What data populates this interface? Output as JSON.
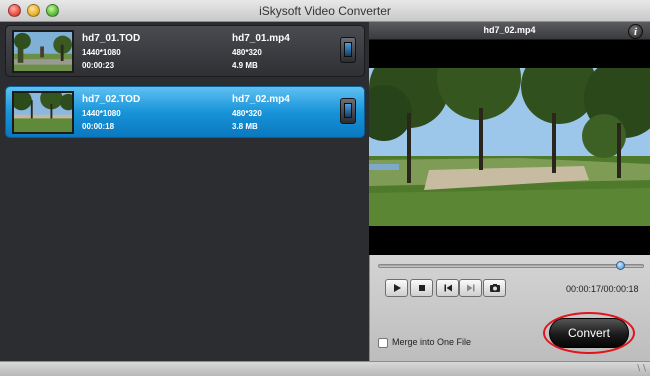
{
  "window": {
    "title": "iSkysoft Video Converter"
  },
  "files": [
    {
      "source_name": "hd7_01.TOD",
      "source_resolution": "1440*1080",
      "source_duration": "00:00:23",
      "output_name": "hd7_01.mp4",
      "output_resolution": "480*320",
      "output_size": "4.9 MB",
      "device_icon": "phone-device-icon",
      "selected": false
    },
    {
      "source_name": "hd7_02.TOD",
      "source_resolution": "1440*1080",
      "source_duration": "00:00:18",
      "output_name": "hd7_02.mp4",
      "output_resolution": "480*320",
      "output_size": "3.8 MB",
      "device_icon": "phone-device-icon",
      "selected": true
    }
  ],
  "preview": {
    "title": "hd7_02.mp4",
    "info_label": "i",
    "progress": 0.95,
    "time_readout": "00:00:17/00:00:18"
  },
  "controls": {
    "play_icon": "play-icon",
    "stop_icon": "stop-icon",
    "prev_icon": "previous-frame-icon",
    "next_icon": "next-frame-icon",
    "snapshot_icon": "snapshot-icon"
  },
  "merge": {
    "label": "Merge into One File",
    "checked": false
  },
  "convert": {
    "label": "Convert"
  },
  "colors": {
    "selected_item": "#1894d9",
    "highlight_ring": "#e0141c",
    "pane_background": "#2c2d31"
  }
}
